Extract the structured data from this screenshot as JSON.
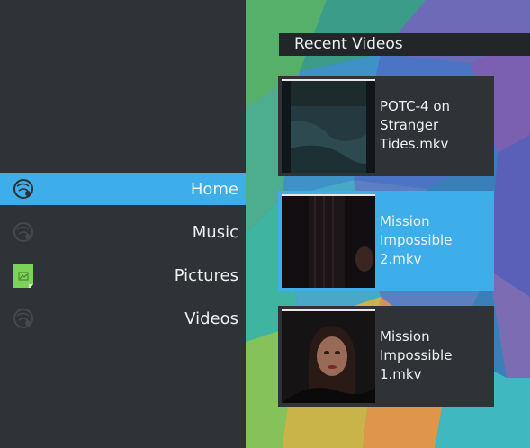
{
  "sidebar": {
    "items": [
      {
        "label": "Home",
        "icon": "home-icon",
        "selected": true
      },
      {
        "label": "Music",
        "icon": "music-icon",
        "selected": false
      },
      {
        "label": "Pictures",
        "icon": "pictures-icon",
        "selected": false
      },
      {
        "label": "Videos",
        "icon": "videos-icon",
        "selected": false
      }
    ]
  },
  "recent": {
    "title": "Recent Videos",
    "videos": [
      {
        "title": "POTC-4 on Stranger Tides.mkv",
        "selected": false
      },
      {
        "title": "Mission Impossible 2.mkv",
        "selected": true
      },
      {
        "title": "Mission Impossible 1.mkv",
        "selected": false
      }
    ]
  },
  "colors": {
    "accent": "#3daee9",
    "panel": "#2f3236",
    "title_bar": "#232629",
    "pictures_icon": "#7dd35a"
  }
}
